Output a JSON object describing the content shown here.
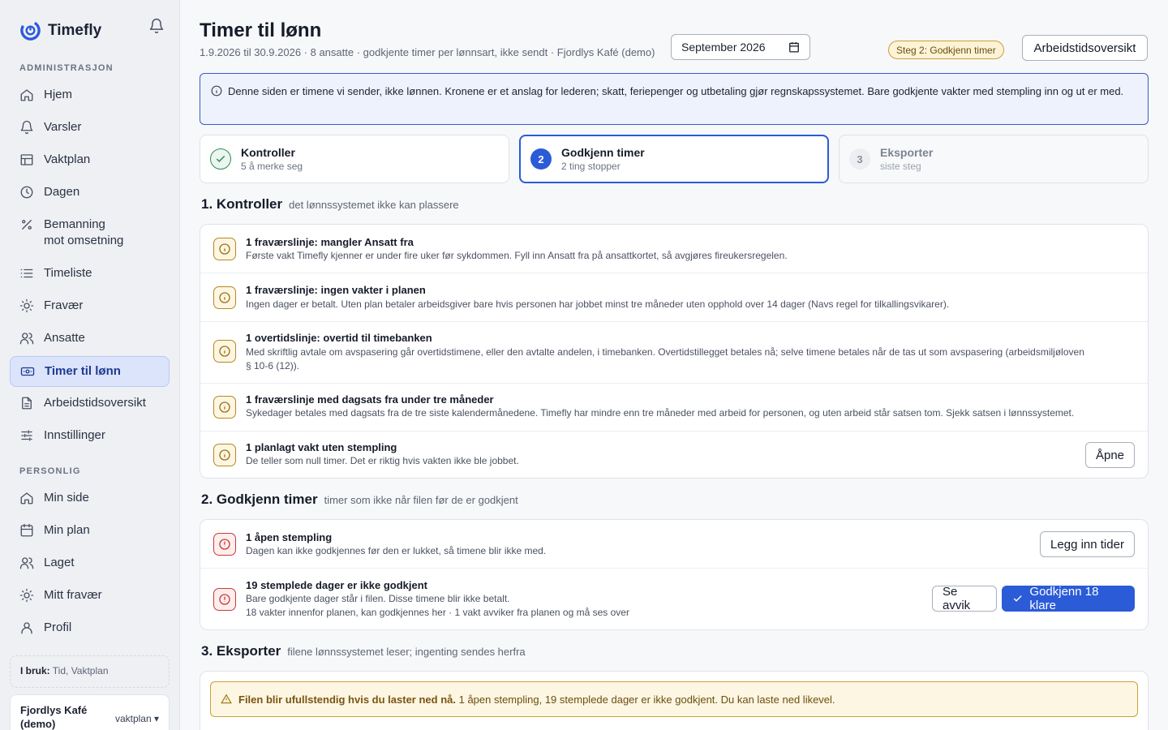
{
  "app": {
    "name": "Timefly"
  },
  "sidebar": {
    "admin_section": "ADMINISTRASJON",
    "admin_items": [
      {
        "label": "Hjem",
        "icon": "home-icon"
      },
      {
        "label": "Varsler",
        "icon": "bell-icon"
      },
      {
        "label": "Vaktplan",
        "icon": "grid-icon"
      },
      {
        "label": "Dagen",
        "icon": "clock-icon"
      },
      {
        "label": "Bemanning\nmot omsetning",
        "icon": "percent-icon"
      },
      {
        "label": "Timeliste",
        "icon": "list-icon"
      },
      {
        "label": "Fravær",
        "icon": "sun-icon"
      },
      {
        "label": "Ansatte",
        "icon": "users-icon"
      },
      {
        "label": "Timer til lønn",
        "icon": "banknote-icon",
        "active": true
      },
      {
        "label": "Arbeidstidsoversikt",
        "icon": "document-icon"
      },
      {
        "label": "Innstillinger",
        "icon": "sliders-icon"
      }
    ],
    "personal_section": "PERSONLIG",
    "personal_items": [
      {
        "label": "Min side",
        "icon": "home-icon"
      },
      {
        "label": "Min plan",
        "icon": "calendar-icon"
      },
      {
        "label": "Laget",
        "icon": "users-icon"
      },
      {
        "label": "Mitt fravær",
        "icon": "sun-icon"
      },
      {
        "label": "Profil",
        "icon": "user-icon"
      }
    ],
    "in_use_label": "I bruk:",
    "in_use_value": "Tid, Vaktplan",
    "org_name": "Fjordlys Kafé (demo)",
    "org_plan": "vaktplan ▾"
  },
  "header": {
    "title": "Timer til lønn",
    "subtitle": "1.9.2026 til 30.9.2026 · 8 ansatte · godkjente timer per lønnsart, ikke sendt · Fjordlys Kafé (demo)",
    "month_value": "September 2026",
    "step_badge": "Steg 2: Godkjenn timer",
    "overview_button": "Arbeidstidsoversikt"
  },
  "info_banner": "Denne siden er timene vi sender, ikke lønnen. Kronene er et anslag for lederen; skatt, feriepenger og utbetaling gjør regnskapssystemet. Bare godkjente vakter med stempling inn og ut er med.",
  "steps": [
    {
      "num": "✓",
      "title": "Kontroller",
      "desc": "5 å merke seg",
      "state": "done"
    },
    {
      "num": "2",
      "title": "Godkjenn timer",
      "desc": "2 ting stopper",
      "state": "active"
    },
    {
      "num": "3",
      "title": "Eksporter",
      "desc": "siste steg",
      "state": "pending"
    }
  ],
  "section1": {
    "title": "1. Kontroller",
    "subtitle": "det lønnssystemet ikke kan plassere",
    "rows": [
      {
        "title": "1 fraværslinje: mangler Ansatt fra",
        "desc": "Første vakt Timefly kjenner er under fire uker før sykdommen. Fyll inn Ansatt fra på ansattkortet, så avgjøres fireukersregelen."
      },
      {
        "title": "1 fraværslinje: ingen vakter i planen",
        "desc": "Ingen dager er betalt. Uten plan betaler arbeidsgiver bare hvis personen har jobbet minst tre måneder uten opphold over 14 dager (Navs regel for tilkallingsvikarer)."
      },
      {
        "title": "1 overtidslinje: overtid til timebanken",
        "desc": "Med skriftlig avtale om avspasering går overtidstimene, eller den avtalte andelen, i timebanken. Overtidstillegget betales nå; selve timene betales når de tas ut som avspasering (arbeidsmiljøloven § 10-6 (12))."
      },
      {
        "title": "1 fraværslinje med dagsats fra under tre måneder",
        "desc": "Sykedager betales med dagsats fra de tre siste kalendermånedene. Timefly har mindre enn tre måneder med arbeid for personen, og uten arbeid står satsen tom. Sjekk satsen i lønnssystemet."
      },
      {
        "title": "1 planlagt vakt uten stempling",
        "desc": "De teller som null timer. Det er riktig hvis vakten ikke ble jobbet.",
        "action": "Åpne"
      }
    ]
  },
  "section2": {
    "title": "2. Godkjenn timer",
    "subtitle": "timer som ikke når filen før de er godkjent",
    "rows": [
      {
        "title": "1 åpen stempling",
        "desc": "Dagen kan ikke godkjennes før den er lukket, så timene blir ikke med.",
        "action": "Legg inn tider"
      },
      {
        "title": "19 stemplede dager er ikke godkjent",
        "desc": "Bare godkjente dager står i filen. Disse timene blir ikke betalt.",
        "desc2": "18 vakter innenfor planen, kan godkjennes her · 1 vakt avviker fra planen og må ses over",
        "action": "Se avvik",
        "primary_action": "Godkjenn 18 klare"
      }
    ]
  },
  "section3": {
    "title": "3. Eksporter",
    "subtitle": "filene lønnssystemet leser; ingenting sendes herfra",
    "warning_bold": "Filen blir ufullstendig hvis du laster ned nå.",
    "warning_text": " 1 åpen stempling, 19 stemplede dager er ikke godkjent. Du kan laste ned likevel."
  },
  "colors": {
    "accent": "#2b5bd7",
    "warning": "#b58a20",
    "error": "#c93a3a",
    "success": "#2e8b57"
  }
}
